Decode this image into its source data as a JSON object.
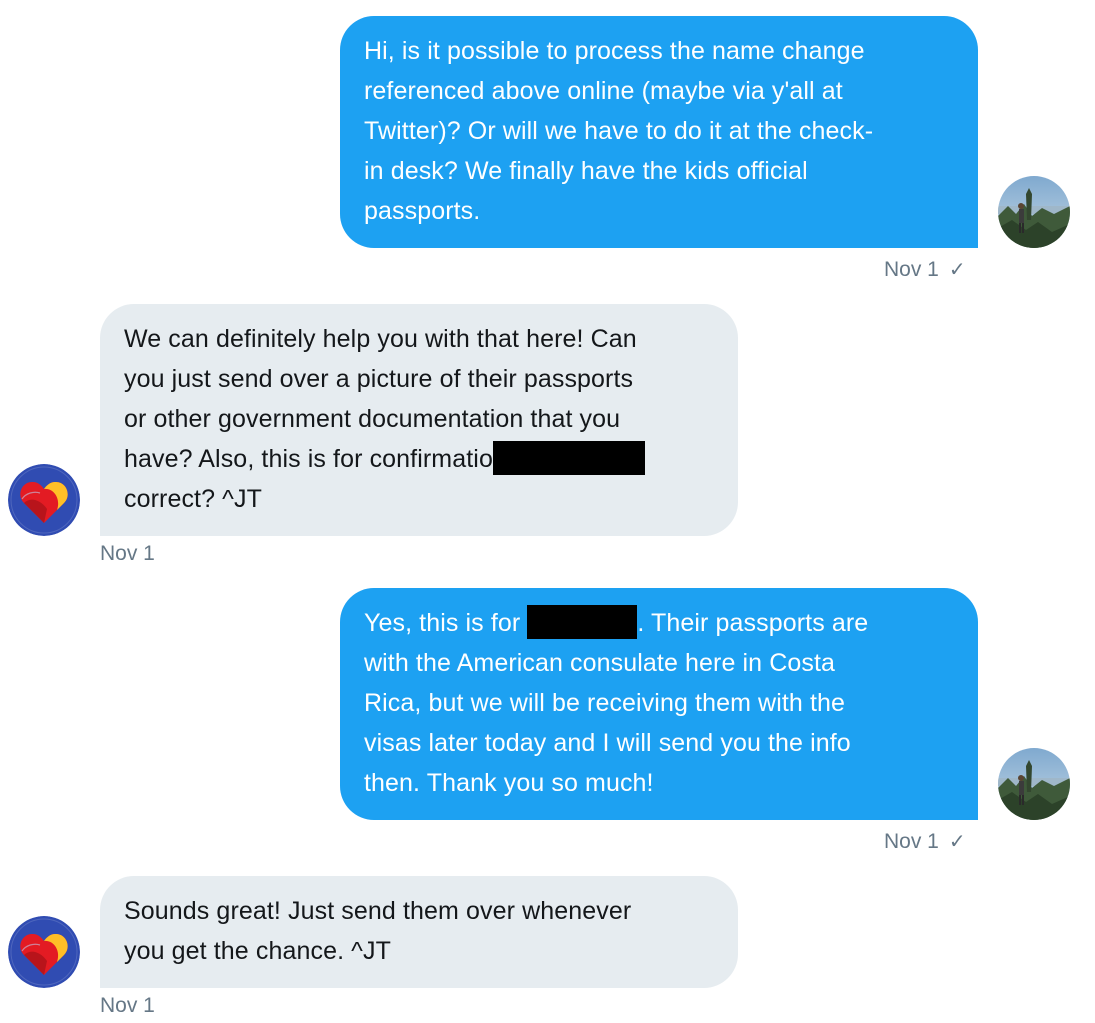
{
  "conversation": {
    "messages": [
      {
        "direction": "sent",
        "lines": [
          "Hi, is it possible to process the name change",
          "referenced above online (maybe via y'all at",
          "Twitter)? Or will we have to do it at the check-",
          "in desk? We finally have the kids official",
          "passports."
        ],
        "timestamp": "Nov 1",
        "status_icon": "checkmark-icon",
        "status_glyph": "✓"
      },
      {
        "direction": "received",
        "lines": [
          "We can definitely help you with that here! Can",
          "you just send over a picture of their passports",
          "or other government documentation that you",
          "have? Also, this is for confirmatio",
          "correct? ^JT"
        ],
        "timestamp": "Nov 1"
      },
      {
        "direction": "sent",
        "line1_before": "Yes, this is for ",
        "line1_after": ". Their passports are",
        "lines": [
          "with the American consulate here in Costa",
          "Rica, but we will be receiving them with the",
          "visas later today and I will send you the info",
          "then. Thank you so much!"
        ],
        "timestamp": "Nov 1",
        "status_icon": "checkmark-icon",
        "status_glyph": "✓"
      },
      {
        "direction": "received",
        "lines": [
          "Sounds great! Just send them over whenever",
          "you get the chance. ^JT"
        ],
        "timestamp": "Nov 1"
      }
    ],
    "avatars": {
      "user": "user-landscape-avatar",
      "brand": "southwest-heart-logo-avatar"
    },
    "colors": {
      "sent_bubble": "#1da1f2",
      "received_bubble": "#e6ecf0",
      "timestamp": "#657786",
      "brand_navy": "#304cb2",
      "brand_red": "#e31b23",
      "brand_yellow": "#ffbf27"
    }
  }
}
